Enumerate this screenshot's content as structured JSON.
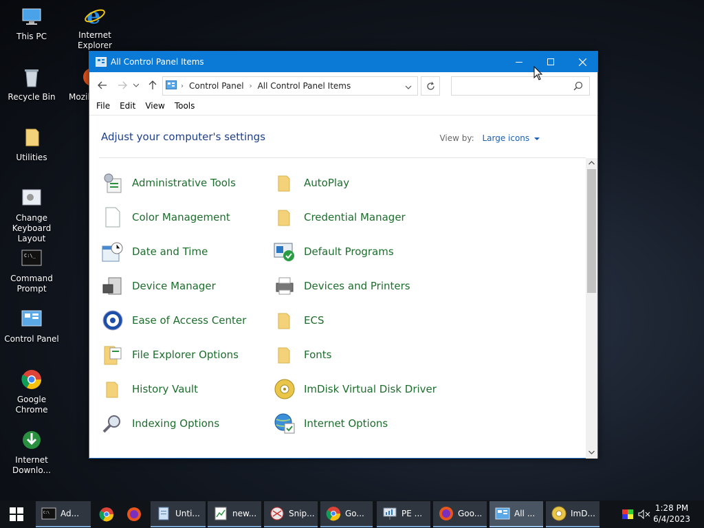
{
  "desktop": {
    "icons": [
      {
        "label": "This PC"
      },
      {
        "label": "Internet Explorer"
      },
      {
        "label": "Recycle Bin"
      },
      {
        "label": "Mozil"
      },
      {
        "label": "Utilities"
      },
      {
        "label": "Change Keyboard Layout"
      },
      {
        "label": "Command Prompt"
      },
      {
        "label": "Control Panel"
      },
      {
        "label": "Google Chrome"
      },
      {
        "label": "Internet Downlo..."
      }
    ]
  },
  "window": {
    "title": "All Control Panel Items",
    "breadcrumb": [
      "Control Panel",
      "All Control Panel Items"
    ],
    "search_placeholder": "",
    "menu": [
      "File",
      "Edit",
      "View",
      "Tools"
    ],
    "heading": "Adjust your computer's settings",
    "view_by_label": "View by:",
    "view_by_value": "Large icons",
    "items_left": [
      "Administrative Tools",
      "Color Management",
      "Date and Time",
      "Device Manager",
      "Ease of Access Center",
      "File Explorer Options",
      "History Vault",
      "Indexing Options"
    ],
    "items_right": [
      "AutoPlay",
      "Credential Manager",
      "Default Programs",
      "Devices and Printers",
      "ECS",
      "Fonts",
      "ImDisk Virtual Disk Driver",
      "Internet Options"
    ]
  },
  "taskbar": {
    "items": [
      "Ad...",
      "Unti...",
      "new...",
      "Snip...",
      "Go...",
      "PE ...",
      "Goo...",
      "All ...",
      "ImD..."
    ],
    "time": "1:28 PM",
    "date": "6/4/2023"
  },
  "colors": {
    "titlebar": "#0a7ad6",
    "link_green": "#1c6e2c",
    "heading_blue": "#1e3f8a"
  }
}
